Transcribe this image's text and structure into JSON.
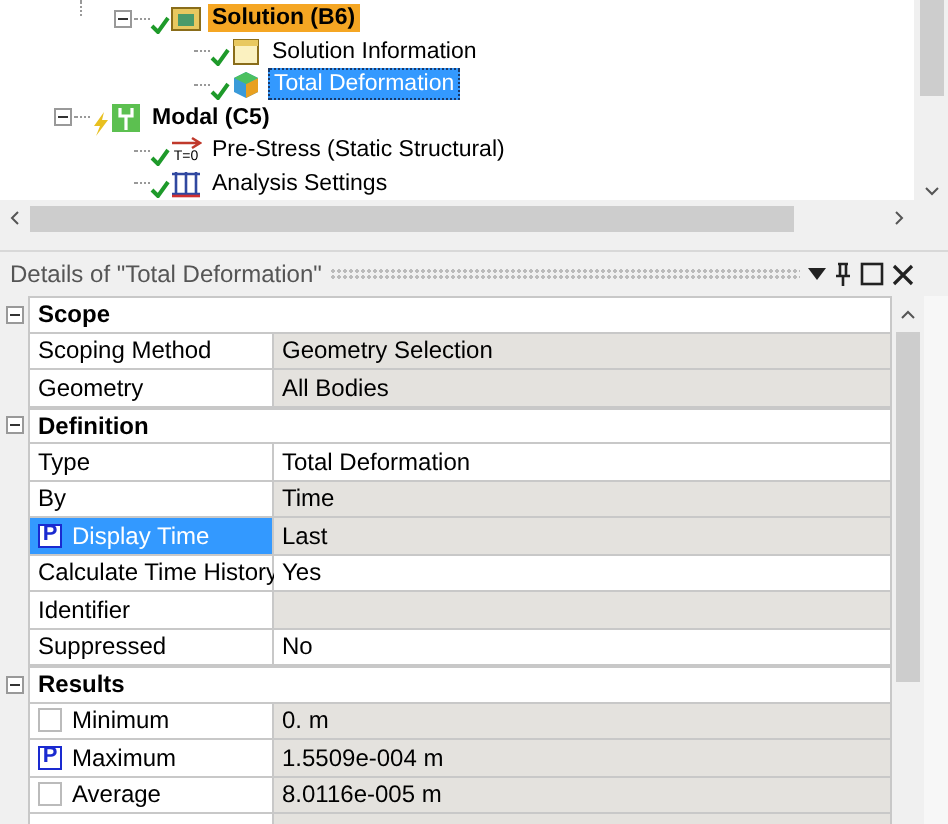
{
  "tree": [
    {
      "expanded": true,
      "children": [
        {
          "label": "Solution (B6)",
          "kind": "solution",
          "solved": true,
          "highlighted": true,
          "selected": false,
          "expanded": true,
          "children": [
            {
              "label": "Solution Information",
              "kind": "info",
              "solved": true,
              "highlighted": false,
              "selected": false
            },
            {
              "label": "Total Deformation",
              "kind": "deformation",
              "solved": true,
              "selected": true
            }
          ]
        }
      ]
    },
    {
      "label": "Modal (C5)",
      "kind": "modal",
      "solved": false,
      "highlighted": false,
      "selected": false,
      "expanded": true,
      "children": [
        {
          "label": "Pre-Stress (Static Structural)",
          "kind": "prestress",
          "icon_text": "T=0",
          "solved": true,
          "highlighted": false,
          "selected": false
        },
        {
          "label": "Analysis Settings",
          "kind": "settings",
          "solved": true,
          "highlighted": false,
          "selected": false
        }
      ]
    }
  ],
  "details": {
    "title": "Details of \"Total Deformation\"",
    "groups": [
      {
        "label": "Scope",
        "expanded": true,
        "rows": [
          {
            "name": "Scoping Method",
            "value": "Geometry Selection",
            "readonly": true,
            "selected": false
          },
          {
            "name": "Geometry",
            "value": "All Bodies",
            "readonly": true,
            "selected": false
          }
        ]
      },
      {
        "label": "Definition",
        "expanded": true,
        "rows": [
          {
            "name": "Type",
            "value": "Total Deformation",
            "readonly": false,
            "selected": false
          },
          {
            "name": "By",
            "value": "Time",
            "readonly": true,
            "selected": false
          },
          {
            "name": "Display Time",
            "value": "Last",
            "readonly": true,
            "selected": true,
            "parameter": {
              "checked": true,
              "text": "P"
            }
          },
          {
            "name": "Calculate Time History",
            "value": "Yes",
            "readonly": false,
            "selected": false
          },
          {
            "name": "Identifier",
            "value": "",
            "readonly": true,
            "selected": false
          },
          {
            "name": "Suppressed",
            "value": "No",
            "readonly": false,
            "selected": false
          }
        ]
      },
      {
        "label": "Results",
        "expanded": true,
        "rows": [
          {
            "name": "Minimum",
            "value": "0. m",
            "readonly": true,
            "selected": false,
            "parameter": {
              "checked": false
            }
          },
          {
            "name": "Maximum",
            "value": "1.5509e-004 m",
            "readonly": true,
            "selected": false,
            "parameter": {
              "checked": true,
              "text": "P"
            }
          },
          {
            "name": "Average",
            "value": "8.0116e-005 m",
            "readonly": true,
            "selected": false,
            "parameter": {
              "checked": false
            }
          }
        ]
      }
    ]
  }
}
